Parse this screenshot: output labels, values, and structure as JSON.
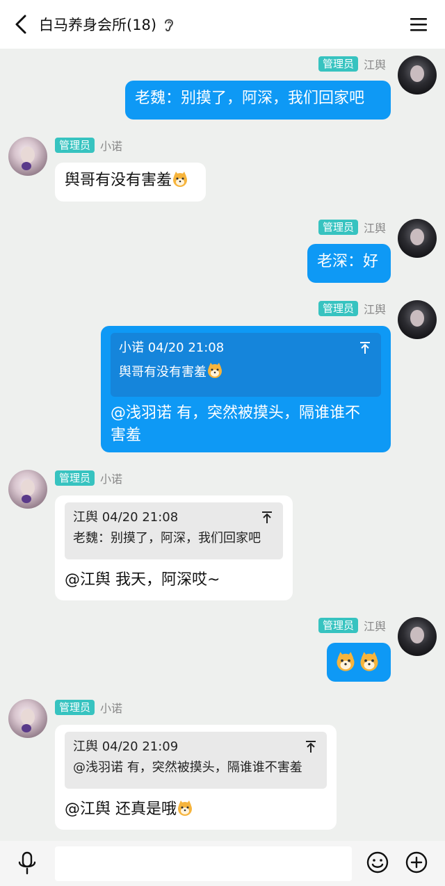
{
  "header": {
    "title": "白马养身会所(18)",
    "back_icon": "chevron-left-icon",
    "ear_icon": "ear-icon",
    "menu_icon": "hamburger-menu-icon"
  },
  "messages": [
    {
      "direction": "out",
      "badge": "管理员",
      "sender": "江舆",
      "text": "老魏：别摸了，阿深，我们回家吧"
    },
    {
      "direction": "in",
      "badge": "管理员",
      "sender": "小诺",
      "text": "舆哥有没有害羞",
      "emoji": "shiba-dog-emoji"
    },
    {
      "direction": "out",
      "badge": "管理员",
      "sender": "江舆",
      "text": "老深：好"
    },
    {
      "direction": "out",
      "badge": "管理员",
      "sender": "江舆",
      "quote": {
        "sender_time": "小诺 04/20 21:08",
        "text": "舆哥有没有害羞",
        "emoji": "shiba-dog-emoji"
      },
      "text_line1": "@浅羽诺 有，突然被摸头，隔谁谁不",
      "text_line2": "害羞"
    },
    {
      "direction": "in",
      "badge": "管理员",
      "sender": "小诺",
      "quote": {
        "sender_time": "江舆 04/20 21:08",
        "text": "老魏：别摸了，阿深，我们回家吧"
      },
      "text": "@江舆 我天，阿深哎~"
    },
    {
      "direction": "out",
      "badge": "管理员",
      "sender": "江舆",
      "emojis": [
        "shiba-dog-emoji",
        "shiba-dog-emoji"
      ]
    },
    {
      "direction": "in",
      "badge": "管理员",
      "sender": "小诺",
      "quote": {
        "sender_time": "江舆 04/20 21:09",
        "text": "@浅羽诺 有，突然被摸头，隔谁谁不害羞"
      },
      "text": "@江舆 还真是哦",
      "emoji": "shiba-dog-emoji"
    }
  ],
  "input_bar": {
    "mic_icon": "microphone-icon",
    "placeholder": "",
    "emoji_icon": "smiley-icon",
    "plus_icon": "plus-circle-icon"
  },
  "colors": {
    "outgoing_bubble": "#0e99f5",
    "incoming_bubble": "#ffffff",
    "admin_badge": "#37c3c0",
    "background": "#eef0ee"
  }
}
